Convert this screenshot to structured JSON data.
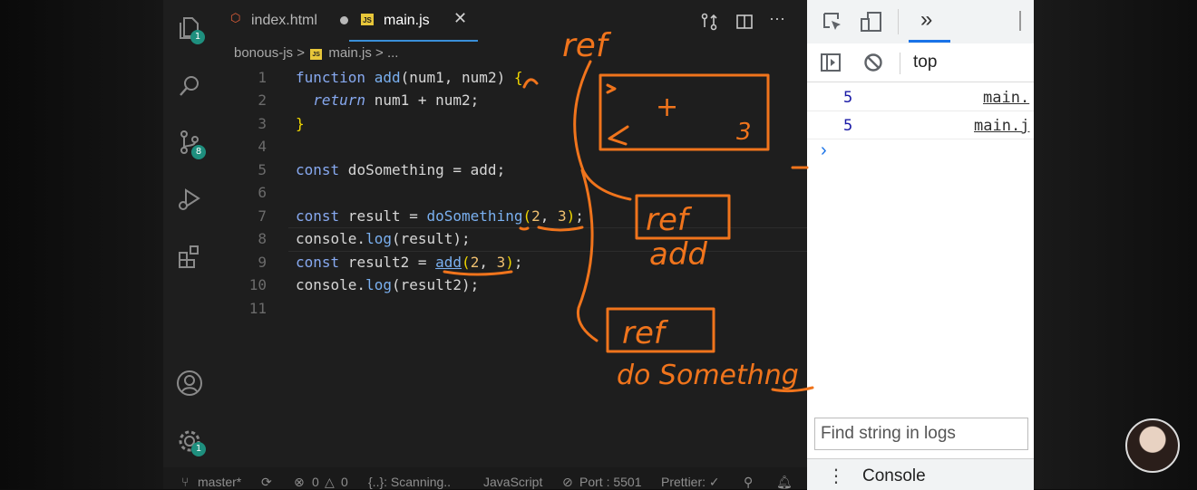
{
  "tabs": [
    {
      "icon": "html5-icon",
      "label": "index.html",
      "modified": true
    },
    {
      "icon": "js-icon",
      "label": "main.js",
      "active": true
    }
  ],
  "breadcrumb": {
    "folder": "bonous-js",
    "separator": ">",
    "file": "main.js",
    "tail": "> ..."
  },
  "activity_badges": {
    "explorer": "1",
    "source_control": "8",
    "settings": "1"
  },
  "line_numbers": [
    "1",
    "2",
    "3",
    "4",
    "5",
    "6",
    "7",
    "8",
    "9",
    "10",
    "11"
  ],
  "code": {
    "l1": {
      "kw": "function",
      "name": "add",
      "params": "(num1, num2) ",
      "brace": "{"
    },
    "l2": {
      "kw": "return",
      "expr": " num1 + num2;"
    },
    "l3": {
      "brace": "}"
    },
    "l5": {
      "kw": "const",
      "rest": " doSomething = add;"
    },
    "l7": {
      "kw": "const",
      "mid": " result = ",
      "fn": "doSomething",
      "open": "(",
      "a": "2",
      "comma": ", ",
      "b": "3",
      "close": ")",
      "end": ";"
    },
    "l8": {
      "obj": "console.",
      "fn": "log",
      "rest": "(result);"
    },
    "l9": {
      "kw": "const",
      "mid": " result2 = ",
      "fn": "add",
      "open": "(",
      "a": "2",
      "comma": ", ",
      "b": "3",
      "close": ")",
      "end": ";"
    },
    "l10": {
      "obj": "console.",
      "fn": "log",
      "rest": "(result2);"
    }
  },
  "statusbar": {
    "branch": "master*",
    "problems": "0",
    "warnings": "0",
    "scanning": "{..}: Scanning..",
    "language": "JavaScript",
    "port": "Port : 5501",
    "prettier": "Prettier: ✓"
  },
  "devtools": {
    "more_tabs": "»",
    "context": "top",
    "logs": [
      {
        "value": "5",
        "source": "main."
      },
      {
        "value": "5",
        "source": "main.j"
      }
    ],
    "prompt": "›",
    "find_placeholder": "Find string in logs",
    "drawer_menu": "⋮",
    "drawer_tab": "Console"
  },
  "annotations": {
    "ref_top": "ref",
    "ref_mid": "ref",
    "label_mid": "add",
    "ref_bottom": "ref",
    "label_bottom": "do Somethng",
    "box_symbol_plus": "+",
    "box_symbol_3": "3"
  },
  "colors": {
    "annotation": "#f0741c",
    "accent": "#3a8fd9",
    "badge": "#1e8f7e"
  }
}
